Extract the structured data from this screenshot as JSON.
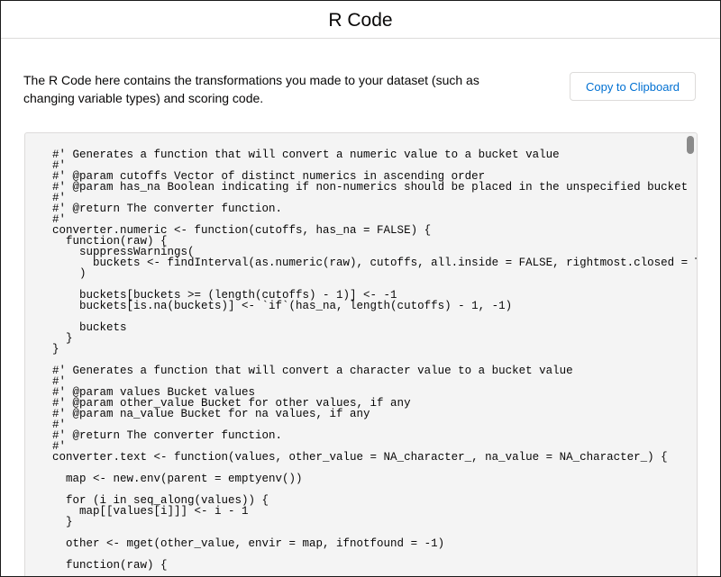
{
  "modal": {
    "title": "R Code",
    "description": "The R Code here contains the transformations you made to your dataset (such as changing variable types) and scoring code.",
    "copy_button_label": "Copy to Clipboard"
  },
  "code_lines": [
    "#' Generates a function that will convert a numeric value to a bucket value",
    "#'",
    "#' @param cutoffs Vector of distinct numerics in ascending order",
    "#' @param has_na Boolean indicating if non-numerics should be placed in the unspecified bucket",
    "#'",
    "#' @return The converter function.",
    "#'",
    "converter.numeric <- function(cutoffs, has_na = FALSE) {",
    "  function(raw) {",
    "    suppressWarnings(",
    "      buckets <- findInterval(as.numeric(raw), cutoffs, all.inside = FALSE, rightmost.closed = TRUE)",
    "    )",
    "",
    "    buckets[buckets >= (length(cutoffs) - 1)] <- -1",
    "    buckets[is.na(buckets)] <- `if`(has_na, length(cutoffs) - 1, -1)",
    "",
    "    buckets",
    "  }",
    "}",
    "",
    "#' Generates a function that will convert a character value to a bucket value",
    "#'",
    "#' @param values Bucket values",
    "#' @param other_value Bucket for other values, if any",
    "#' @param na_value Bucket for na values, if any",
    "#'",
    "#' @return The converter function.",
    "#'",
    "converter.text <- function(values, other_value = NA_character_, na_value = NA_character_) {",
    "",
    "  map <- new.env(parent = emptyenv())",
    "",
    "  for (i in seq_along(values)) {",
    "    map[[values[i]]] <- i - 1",
    "  }",
    "",
    "  other <- mget(other_value, envir = map, ifnotfound = -1)",
    "",
    "  function(raw) {"
  ]
}
